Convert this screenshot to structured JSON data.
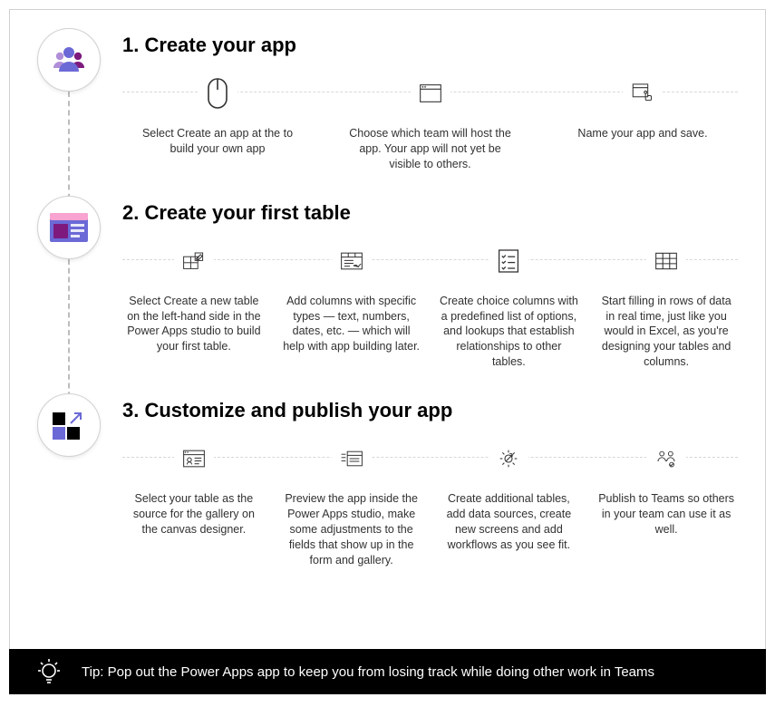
{
  "sections": [
    {
      "title": "1. Create your app",
      "steps": [
        {
          "text": "Select Create an app at the to build your own app"
        },
        {
          "text": "Choose which team will host the app. Your app will not yet be visible to others."
        },
        {
          "text": "Name your app and save."
        }
      ]
    },
    {
      "title": "2. Create your first table",
      "steps": [
        {
          "text": "Select Create a new table on the left-hand side in the Power Apps studio to build your first table."
        },
        {
          "text": "Add columns with specific types — text, numbers, dates, etc. — which will help with app building later."
        },
        {
          "text": "Create choice columns with a predefined list of options, and lookups that establish relationships to other tables."
        },
        {
          "text": "Start filling in rows of data in real time, just like you would in Excel, as you're designing your tables and columns."
        }
      ]
    },
    {
      "title": "3. Customize and publish your app",
      "steps": [
        {
          "text": "Select your table as the source for the gallery on the canvas designer."
        },
        {
          "text": "Preview the app inside the Power Apps studio, make some adjustments to the fields that show up in the form and gallery."
        },
        {
          "text": "Create additional tables, add data sources, create new screens and add workflows as you see fit."
        },
        {
          "text": "Publish to Teams so others in your team can use it as well."
        }
      ]
    }
  ],
  "tip": "Tip: Pop out the Power Apps app to keep you from losing track while doing other work in Teams"
}
